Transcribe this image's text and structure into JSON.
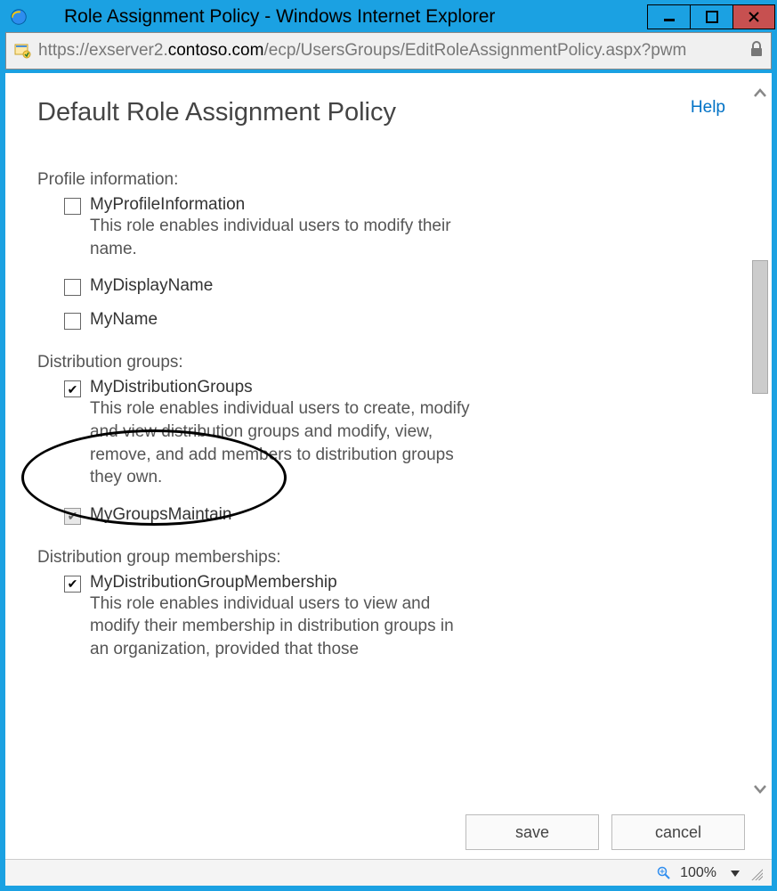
{
  "window": {
    "title": "Role Assignment Policy - Windows Internet Explorer"
  },
  "address": {
    "prefix": "https://exserver2.",
    "domain": "contoso.com",
    "suffix": "/ecp/UsersGroups/EditRoleAssignmentPolicy.aspx?pwm"
  },
  "page": {
    "help": "Help",
    "title": "Default Role Assignment Policy"
  },
  "sections": {
    "profile": {
      "label": "Profile information:",
      "role": {
        "name": "MyProfileInformation",
        "desc": "This role enables individual users to modify their name.",
        "checked": false
      },
      "subs": [
        {
          "name": "MyDisplayName",
          "checked": false
        },
        {
          "name": "MyName",
          "checked": false
        }
      ]
    },
    "dist": {
      "label": "Distribution groups:",
      "role": {
        "name": "MyDistributionGroups",
        "desc": "This role enables individual users to create, modify and view distribution groups and modify, view, remove, and add members to distribution groups they own.",
        "checked": true
      },
      "subs": [
        {
          "name": "MyGroupsMaintain",
          "checked": true,
          "disabled": true
        }
      ]
    },
    "distmember": {
      "label": "Distribution group memberships:",
      "role": {
        "name": "MyDistributionGroupMembership",
        "desc": "This role enables individual users to view and modify their membership in distribution groups in an organization, provided that those",
        "checked": true
      }
    }
  },
  "buttons": {
    "save": "save",
    "cancel": "cancel"
  },
  "status": {
    "zoom": "100%"
  }
}
